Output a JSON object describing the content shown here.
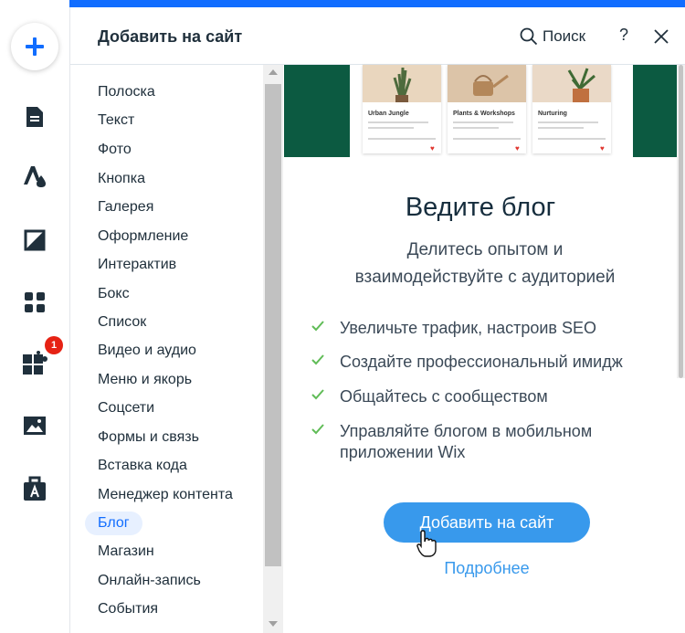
{
  "header": {
    "title": "Добавить на сайт",
    "search_label": "Поиск",
    "help_label": "?"
  },
  "toolbar": {
    "items": [
      {
        "icon": "plus-icon"
      },
      {
        "icon": "page-icon"
      },
      {
        "icon": "theme-icon"
      },
      {
        "icon": "background-icon"
      },
      {
        "icon": "apps-icon"
      },
      {
        "icon": "puzzle-icon",
        "badge": "1"
      },
      {
        "icon": "media-icon"
      },
      {
        "icon": "briefcase-icon"
      }
    ]
  },
  "categories": [
    {
      "label": "Полоска"
    },
    {
      "label": "Текст"
    },
    {
      "label": "Фото"
    },
    {
      "label": "Кнопка"
    },
    {
      "label": "Галерея"
    },
    {
      "label": "Оформление"
    },
    {
      "label": "Интерактив"
    },
    {
      "label": "Бокс"
    },
    {
      "label": "Список"
    },
    {
      "label": "Видео и аудио"
    },
    {
      "label": "Меню и якорь"
    },
    {
      "label": "Соцсети"
    },
    {
      "label": "Формы и связь"
    },
    {
      "label": "Вставка кода"
    },
    {
      "label": "Менеджер контента"
    },
    {
      "label": "Блог",
      "active": true
    },
    {
      "label": "Магазин"
    },
    {
      "label": "Онлайн-запись"
    },
    {
      "label": "События"
    }
  ],
  "preview": {
    "cards": [
      {
        "title": "Urban Jungle"
      },
      {
        "title": "Plants & Workshops"
      },
      {
        "title": "Nurturing"
      }
    ]
  },
  "blog": {
    "title": "Ведите блог",
    "subtitle_line1": "Делитесь опытом и",
    "subtitle_line2": "взаимодействуйте с аудиторией",
    "features": [
      "Увеличьте трафик, настроив SEO",
      "Создайте профессиональный имидж",
      "Общайтесь с сообществом",
      "Управляйте блогом в мобильном приложении Wix"
    ],
    "add_button": "Добавить на сайт",
    "more_link": "Подробнее"
  },
  "colors": {
    "accent": "#116dff",
    "button": "#3899ec",
    "check": "#60bc57",
    "hero_green": "#0c5a41",
    "badge": "#e62214"
  }
}
